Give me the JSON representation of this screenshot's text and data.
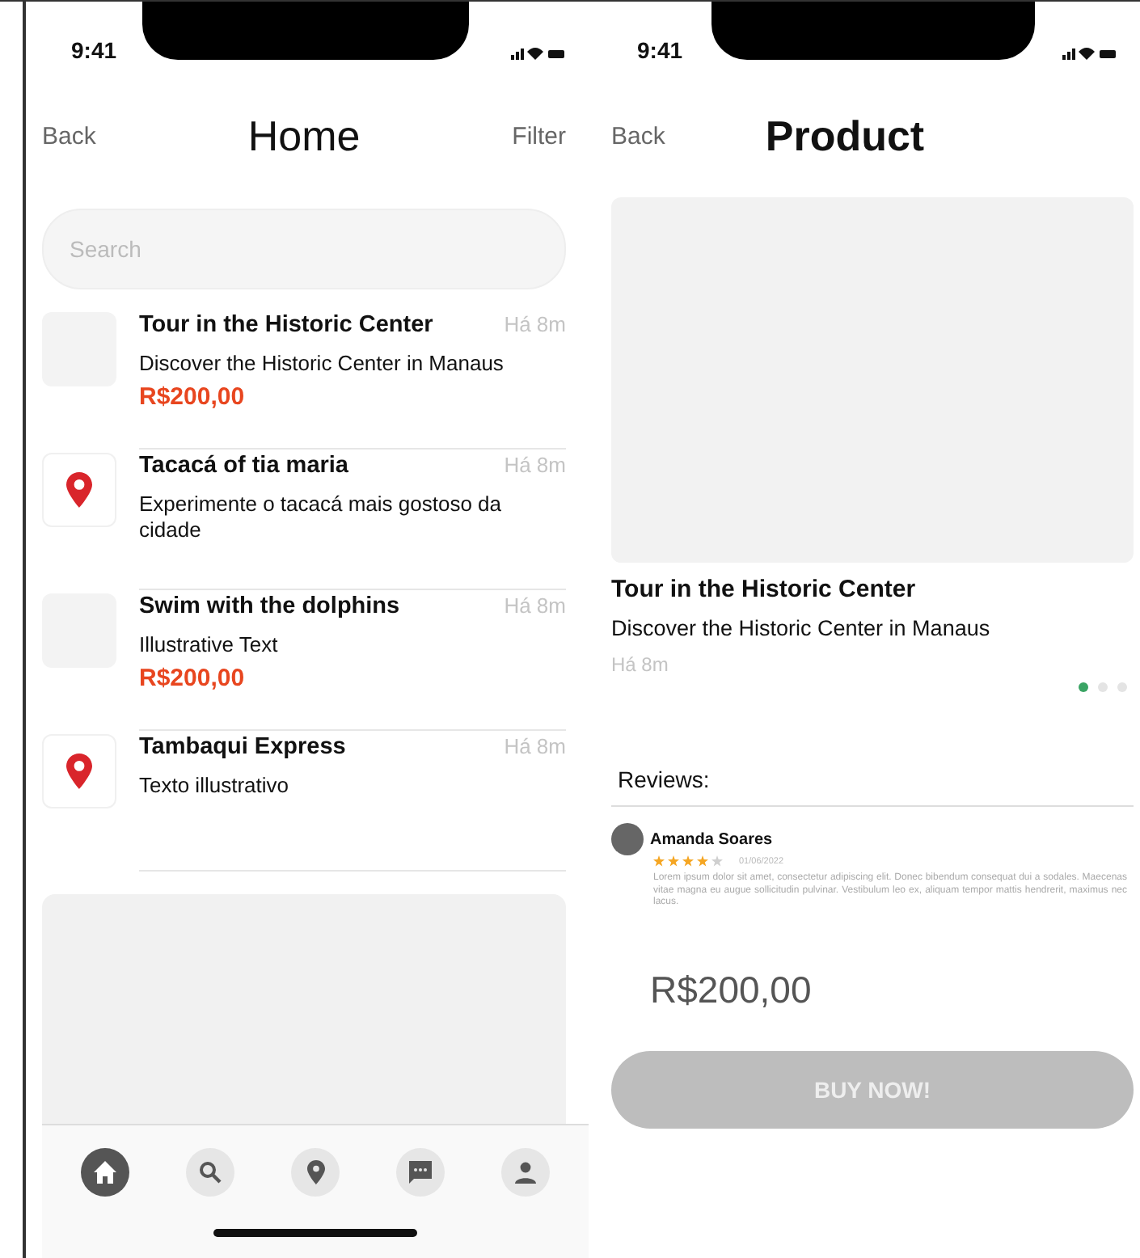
{
  "home": {
    "status_time": "9:41",
    "nav": {
      "back": "Back",
      "title": "Home",
      "action": "Filter"
    },
    "search": {
      "placeholder": "Search"
    },
    "items": [
      {
        "kind": "image",
        "title": "Tour in the Historic Center",
        "time": "Há 8m",
        "description": "Discover the Historic Center in Manaus",
        "price": "R$200,00"
      },
      {
        "kind": "pin",
        "title": "Tacacá of tia maria",
        "time": "Há 8m",
        "description": "Experimente o tacacá mais gostoso da cidade"
      },
      {
        "kind": "image",
        "title": "Swim with the dolphins",
        "time": "Há 8m",
        "description": "Illustrative Text",
        "price": "R$200,00"
      },
      {
        "kind": "pin",
        "title": "Tambaqui Express",
        "time": "Há 8m",
        "description": "Texto illustrativo"
      }
    ],
    "tab_bar": [
      {
        "kind": "home",
        "selected": true
      },
      {
        "kind": "search",
        "selected": false
      },
      {
        "kind": "pin",
        "selected": false
      },
      {
        "kind": "chat",
        "selected": false
      },
      {
        "kind": "person",
        "selected": false
      }
    ]
  },
  "product": {
    "status_time": "9:41",
    "nav": {
      "back": "Back",
      "title": "Product"
    },
    "title": "Tour in the Historic Center",
    "description": "Discover the Historic Center in Manaus",
    "time": "Há 8m",
    "page_dots": [
      {
        "selected": true
      },
      {
        "selected": false
      },
      {
        "selected": false
      }
    ],
    "reviews_heading": "Reviews:",
    "reviews": [
      {
        "author": "Amanda Soares",
        "stars": 4,
        "date": "01/06/2022",
        "text": "Lorem ipsum dolor sit amet, consectetur adipiscing elit. Donec bibendum consequat dui a sodales. Maecenas vitae magna eu augue sollicitudin pulvinar. Vestibulum leo ex, aliquam tempor mattis hendrerit, maximus nec lacus."
      }
    ],
    "price": "R$200,00",
    "buy_button": "BUY NOW!"
  }
}
